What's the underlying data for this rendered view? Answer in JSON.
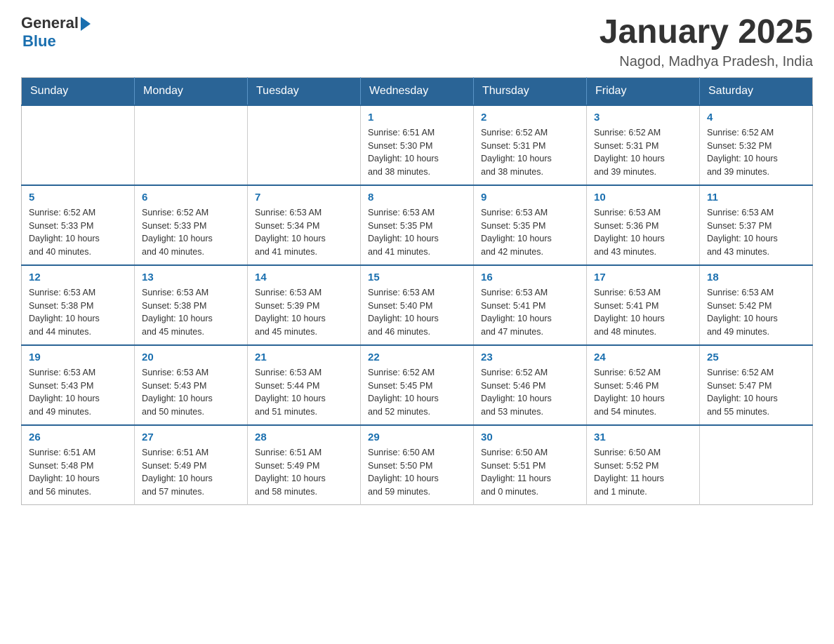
{
  "header": {
    "logo_general": "General",
    "logo_blue": "Blue",
    "month_title": "January 2025",
    "location": "Nagod, Madhya Pradesh, India"
  },
  "days_of_week": [
    "Sunday",
    "Monday",
    "Tuesday",
    "Wednesday",
    "Thursday",
    "Friday",
    "Saturday"
  ],
  "weeks": [
    [
      {
        "day": "",
        "info": ""
      },
      {
        "day": "",
        "info": ""
      },
      {
        "day": "",
        "info": ""
      },
      {
        "day": "1",
        "info": "Sunrise: 6:51 AM\nSunset: 5:30 PM\nDaylight: 10 hours\nand 38 minutes."
      },
      {
        "day": "2",
        "info": "Sunrise: 6:52 AM\nSunset: 5:31 PM\nDaylight: 10 hours\nand 38 minutes."
      },
      {
        "day": "3",
        "info": "Sunrise: 6:52 AM\nSunset: 5:31 PM\nDaylight: 10 hours\nand 39 minutes."
      },
      {
        "day": "4",
        "info": "Sunrise: 6:52 AM\nSunset: 5:32 PM\nDaylight: 10 hours\nand 39 minutes."
      }
    ],
    [
      {
        "day": "5",
        "info": "Sunrise: 6:52 AM\nSunset: 5:33 PM\nDaylight: 10 hours\nand 40 minutes."
      },
      {
        "day": "6",
        "info": "Sunrise: 6:52 AM\nSunset: 5:33 PM\nDaylight: 10 hours\nand 40 minutes."
      },
      {
        "day": "7",
        "info": "Sunrise: 6:53 AM\nSunset: 5:34 PM\nDaylight: 10 hours\nand 41 minutes."
      },
      {
        "day": "8",
        "info": "Sunrise: 6:53 AM\nSunset: 5:35 PM\nDaylight: 10 hours\nand 41 minutes."
      },
      {
        "day": "9",
        "info": "Sunrise: 6:53 AM\nSunset: 5:35 PM\nDaylight: 10 hours\nand 42 minutes."
      },
      {
        "day": "10",
        "info": "Sunrise: 6:53 AM\nSunset: 5:36 PM\nDaylight: 10 hours\nand 43 minutes."
      },
      {
        "day": "11",
        "info": "Sunrise: 6:53 AM\nSunset: 5:37 PM\nDaylight: 10 hours\nand 43 minutes."
      }
    ],
    [
      {
        "day": "12",
        "info": "Sunrise: 6:53 AM\nSunset: 5:38 PM\nDaylight: 10 hours\nand 44 minutes."
      },
      {
        "day": "13",
        "info": "Sunrise: 6:53 AM\nSunset: 5:38 PM\nDaylight: 10 hours\nand 45 minutes."
      },
      {
        "day": "14",
        "info": "Sunrise: 6:53 AM\nSunset: 5:39 PM\nDaylight: 10 hours\nand 45 minutes."
      },
      {
        "day": "15",
        "info": "Sunrise: 6:53 AM\nSunset: 5:40 PM\nDaylight: 10 hours\nand 46 minutes."
      },
      {
        "day": "16",
        "info": "Sunrise: 6:53 AM\nSunset: 5:41 PM\nDaylight: 10 hours\nand 47 minutes."
      },
      {
        "day": "17",
        "info": "Sunrise: 6:53 AM\nSunset: 5:41 PM\nDaylight: 10 hours\nand 48 minutes."
      },
      {
        "day": "18",
        "info": "Sunrise: 6:53 AM\nSunset: 5:42 PM\nDaylight: 10 hours\nand 49 minutes."
      }
    ],
    [
      {
        "day": "19",
        "info": "Sunrise: 6:53 AM\nSunset: 5:43 PM\nDaylight: 10 hours\nand 49 minutes."
      },
      {
        "day": "20",
        "info": "Sunrise: 6:53 AM\nSunset: 5:43 PM\nDaylight: 10 hours\nand 50 minutes."
      },
      {
        "day": "21",
        "info": "Sunrise: 6:53 AM\nSunset: 5:44 PM\nDaylight: 10 hours\nand 51 minutes."
      },
      {
        "day": "22",
        "info": "Sunrise: 6:52 AM\nSunset: 5:45 PM\nDaylight: 10 hours\nand 52 minutes."
      },
      {
        "day": "23",
        "info": "Sunrise: 6:52 AM\nSunset: 5:46 PM\nDaylight: 10 hours\nand 53 minutes."
      },
      {
        "day": "24",
        "info": "Sunrise: 6:52 AM\nSunset: 5:46 PM\nDaylight: 10 hours\nand 54 minutes."
      },
      {
        "day": "25",
        "info": "Sunrise: 6:52 AM\nSunset: 5:47 PM\nDaylight: 10 hours\nand 55 minutes."
      }
    ],
    [
      {
        "day": "26",
        "info": "Sunrise: 6:51 AM\nSunset: 5:48 PM\nDaylight: 10 hours\nand 56 minutes."
      },
      {
        "day": "27",
        "info": "Sunrise: 6:51 AM\nSunset: 5:49 PM\nDaylight: 10 hours\nand 57 minutes."
      },
      {
        "day": "28",
        "info": "Sunrise: 6:51 AM\nSunset: 5:49 PM\nDaylight: 10 hours\nand 58 minutes."
      },
      {
        "day": "29",
        "info": "Sunrise: 6:50 AM\nSunset: 5:50 PM\nDaylight: 10 hours\nand 59 minutes."
      },
      {
        "day": "30",
        "info": "Sunrise: 6:50 AM\nSunset: 5:51 PM\nDaylight: 11 hours\nand 0 minutes."
      },
      {
        "day": "31",
        "info": "Sunrise: 6:50 AM\nSunset: 5:52 PM\nDaylight: 11 hours\nand 1 minute."
      },
      {
        "day": "",
        "info": ""
      }
    ]
  ]
}
